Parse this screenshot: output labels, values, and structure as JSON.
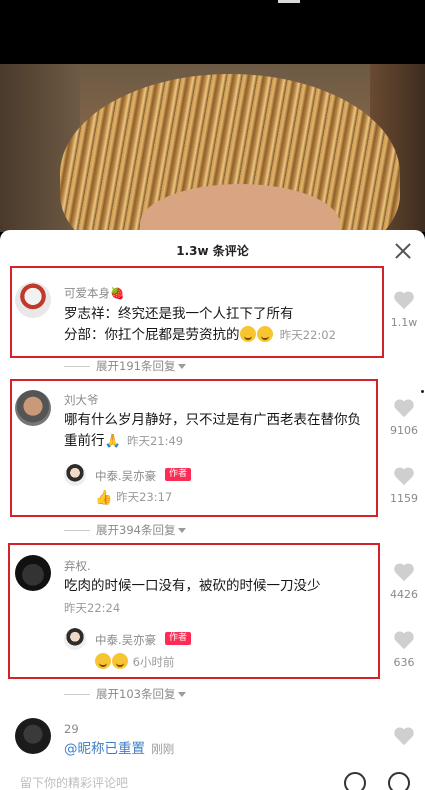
{
  "header": {
    "title": "1.3w 条评论"
  },
  "comments": [
    {
      "username": "可爱本身🍓",
      "line1": "罗志祥：终究还是我一个人扛下了所有",
      "line2": "分部：你扛个屁都是劳资抗的",
      "time": "昨天22:02",
      "likes": "1.1w",
      "expand": "展开191条回复"
    },
    {
      "username": "刘大爷",
      "line1": "哪有什么岁月静好，只不过是有广西老表在替你负",
      "line2": "重前行",
      "time": "昨天21:49",
      "likes": "9106",
      "reply": {
        "username": "中泰.吴亦豪",
        "tag": "作者",
        "time": "昨天23:17",
        "likes": "1159"
      },
      "expand": "展开394条回复"
    },
    {
      "username": "弃权.",
      "line1": "吃肉的时候一口没有，被砍的时候一刀没少",
      "time": "昨天22:24",
      "likes": "4426",
      "reply": {
        "username": "中泰.吴亦豪",
        "tag": "作者",
        "time": "6小时前",
        "likes": "636"
      },
      "expand": "展开103条回复"
    },
    {
      "username": "29",
      "mention": "@昵称已重置",
      "time": "刚刚"
    }
  ],
  "input": {
    "placeholder": "留下你的精彩评论吧"
  },
  "icons": {
    "close": "close-icon",
    "heart": "heart-icon",
    "at": "at-icon",
    "emoji": "emoji-icon"
  },
  "colors": {
    "highlight": "#d2232a",
    "author_tag": "#fe2c55",
    "mention": "#3e7ec4"
  }
}
